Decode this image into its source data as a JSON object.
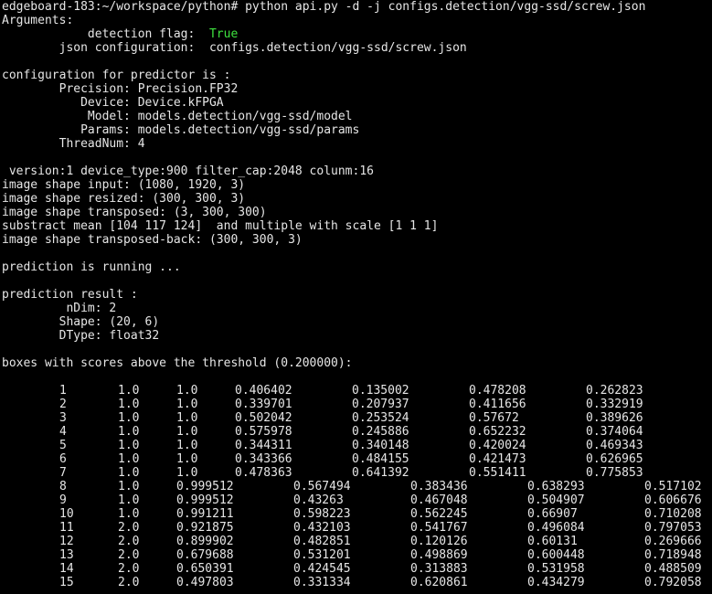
{
  "prompt": "edgeboard-183:~/workspace/python# python api.py -d -j configs.detection/vgg-ssd/screw.json",
  "args": {
    "header": "Arguments:",
    "detection_label": "            detection flag:  ",
    "detection_value": "True",
    "json_line": "        json configuration:  configs.detection/vgg-ssd/screw.json"
  },
  "config": {
    "header": "configuration for predictor is :",
    "lines": [
      "        Precision: Precision.FP32",
      "           Device: Device.kFPGA",
      "            Model: models.detection/vgg-ssd/model",
      "           Params: models.detection/vgg-ssd/params",
      "        ThreadNum: 4"
    ]
  },
  "info": [
    " version:1 device_type:900 filter_cap:2048 colunm:16",
    "image shape input: (1080, 1920, 3)",
    "image shape resized: (300, 300, 3)",
    "image shape transposed: (3, 300, 300)",
    "substract mean [104 117 124]  and multiple with scale [1 1 1]",
    "image shape transposed-back: (300, 300, 3)"
  ],
  "running": "prediction is running ...",
  "result": {
    "header": "prediction result :",
    "lines": [
      "         nDim: 2",
      "        Shape: (20, 6)",
      "        DType: float32"
    ]
  },
  "boxes_header": "boxes with scores above the threshold (0.200000):",
  "boxes_a": [
    [
      "1",
      "1.0",
      "1.0",
      "0.406402",
      "0.135002",
      "0.478208",
      "0.262823"
    ],
    [
      "2",
      "1.0",
      "1.0",
      "0.339701",
      "0.207937",
      "0.411656",
      "0.332919"
    ],
    [
      "3",
      "1.0",
      "1.0",
      "0.502042",
      "0.253524",
      "0.57672",
      "0.389626"
    ],
    [
      "4",
      "1.0",
      "1.0",
      "0.575978",
      "0.245886",
      "0.652232",
      "0.374064"
    ],
    [
      "5",
      "1.0",
      "1.0",
      "0.344311",
      "0.340148",
      "0.420024",
      "0.469343"
    ],
    [
      "6",
      "1.0",
      "1.0",
      "0.343366",
      "0.484155",
      "0.421473",
      "0.626965"
    ],
    [
      "7",
      "1.0",
      "1.0",
      "0.478363",
      "0.641392",
      "0.551411",
      "0.775853"
    ]
  ],
  "boxes_b": [
    [
      "8",
      "1.0",
      "0.999512",
      "0.567494",
      "0.383436",
      "0.638293",
      "0.517102"
    ],
    [
      "9",
      "1.0",
      "0.999512",
      "0.43263",
      "0.467048",
      "0.504907",
      "0.606676"
    ],
    [
      "10",
      "1.0",
      "0.991211",
      "0.598223",
      "0.562245",
      "0.66907",
      "0.710208"
    ],
    [
      "11",
      "2.0",
      "0.921875",
      "0.432103",
      "0.541767",
      "0.496084",
      "0.797053"
    ],
    [
      "12",
      "2.0",
      "0.899902",
      "0.482851",
      "0.120126",
      "0.60131",
      "0.269666"
    ],
    [
      "13",
      "2.0",
      "0.679688",
      "0.531201",
      "0.498869",
      "0.600448",
      "0.718948"
    ],
    [
      "14",
      "2.0",
      "0.650391",
      "0.424545",
      "0.313883",
      "0.531958",
      "0.488509"
    ],
    [
      "15",
      "2.0",
      "0.497803",
      "0.331334",
      "0.620861",
      "0.434279",
      "0.792058"
    ]
  ]
}
